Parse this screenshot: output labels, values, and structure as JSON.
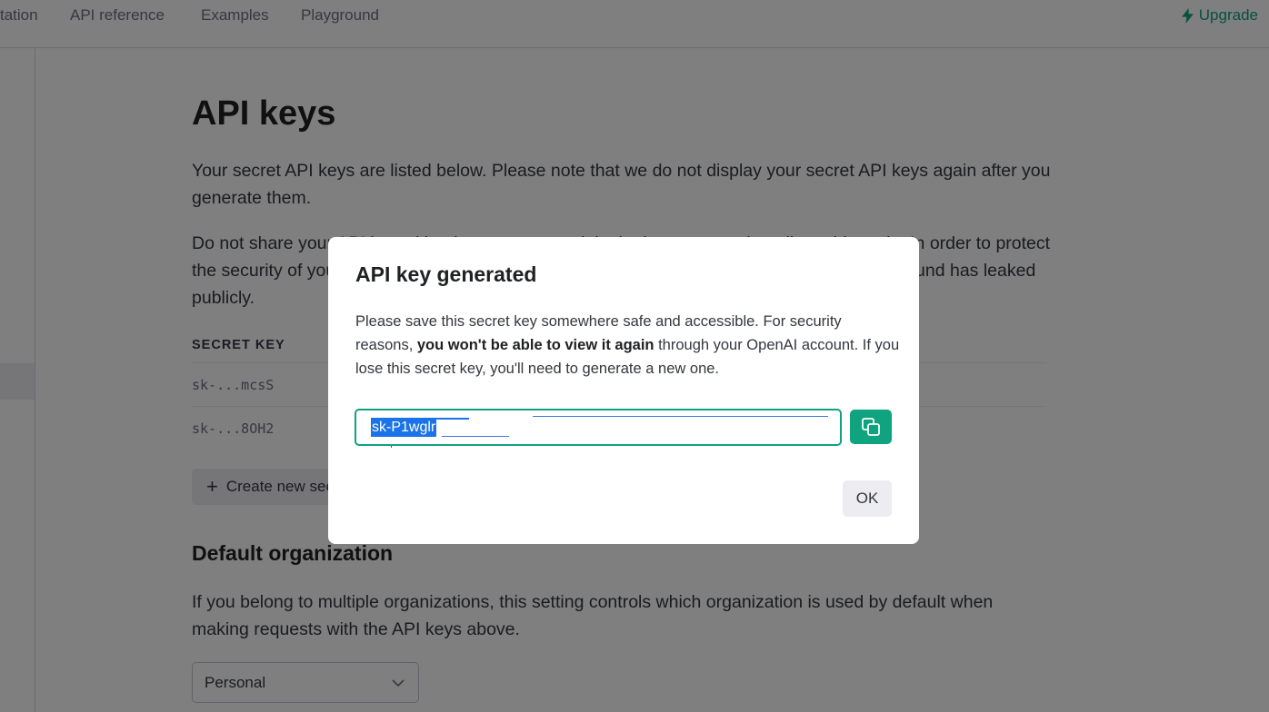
{
  "nav": {
    "items": [
      "tation",
      "API reference",
      "Examples",
      "Playground"
    ],
    "upgrade": "Upgrade"
  },
  "page": {
    "title": "API keys",
    "intro": "Your secret API keys are listed below. Please note that we do not display your secret API keys again after you generate them.",
    "warning": "Do not share your API key with others, or expose it in the browser or other client-side code. In order to protect the security of your account, OpenAI may also automatically rotate any API key that we've found has leaked publicly.",
    "keys_header": "SECRET KEY",
    "keys": [
      "sk-...mcsS",
      "sk-...8OH2"
    ],
    "create_button": "Create new secret key",
    "org_title": "Default organization",
    "org_description": "If you belong to multiple organizations, this setting controls which organization is used by default when making requests with the API keys above.",
    "org_selected": "Personal"
  },
  "modal": {
    "title": "API key generated",
    "body_before": "Please save this secret key somewhere safe and accessible. For security reasons, ",
    "body_bold": "you won't be able to view it again",
    "body_after": " through your OpenAI account. If you lose this secret key, you'll need to generate a new one.",
    "key_value": "sk-P1wglr",
    "ok": "OK"
  },
  "colors": {
    "accent": "#10a37f",
    "selection": "#1a73e8",
    "overlay": "rgba(0,0,0,0.5)"
  },
  "icons": {
    "upgrade": "lightning-bolt-icon",
    "copy": "copy-icon",
    "dropdown": "chevron-down-icon",
    "create": "plus-icon"
  }
}
